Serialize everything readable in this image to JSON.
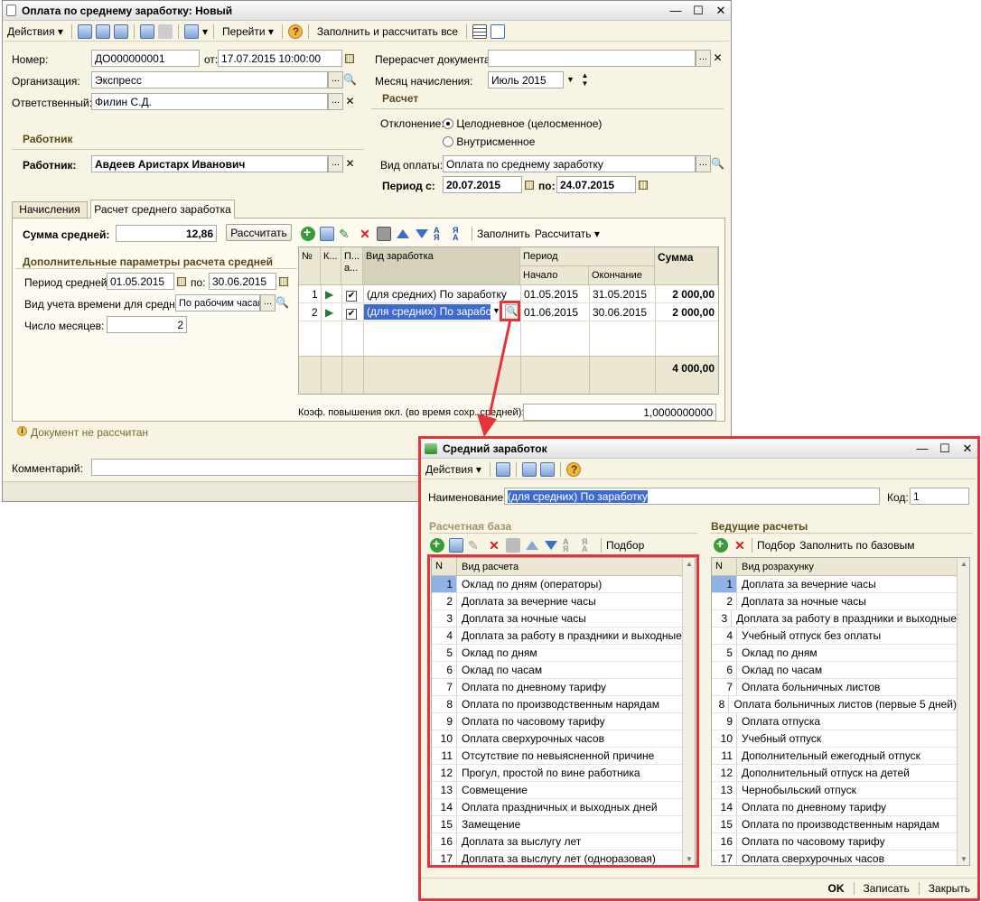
{
  "main": {
    "title": "Оплата по среднему заработку: Новый",
    "toolbar": {
      "actions": "Действия",
      "goto": "Перейти",
      "fill_calc": "Заполнить и рассчитать все"
    },
    "fields": {
      "number_label": "Номер:",
      "number": "ДО000000001",
      "from_label": "от:",
      "date": "17.07.2015 10:00:00",
      "org_label": "Организация:",
      "org": "Экспресс",
      "resp_label": "Ответственный:",
      "resp": "Филин С.Д.",
      "recalc_label": "Перерасчет документа:",
      "recalc": "",
      "month_label": "Месяц начисления:",
      "month": "Июль 2015",
      "calc_section": "Расчет",
      "deviation_label": "Отклонение:",
      "dev_opt1": "Целодневное (целосменное)",
      "dev_opt2": "Внутрисменное",
      "worker_section": "Работник",
      "worker_label": "Работник:",
      "worker": "Авдеев Аристарх Иванович",
      "paytype_label": "Вид оплаты:",
      "paytype": "Оплата по среднему заработку",
      "period_label": "Период с:",
      "period_from": "20.07.2015",
      "period_to_label": "по:",
      "period_to": "24.07.2015"
    },
    "tabs": [
      "Начисления",
      "Расчет среднего заработка"
    ],
    "avg": {
      "sum_label": "Сумма средней:",
      "sum": "12,86",
      "calc_btn": "Рассчитать",
      "params_section": "Дополнительные параметры расчета средней",
      "period_label": "Период средней:",
      "period_from": "01.05.2015",
      "to_label": "по:",
      "period_to": "30.06.2015",
      "time_label": "Вид учета времени для средней:",
      "time": "По рабочим часам",
      "months_label": "Число месяцев:",
      "months": "2"
    },
    "grid_toolbar": {
      "fill": "Заполнить",
      "calc": "Рассчитать"
    },
    "grid": {
      "headers": {
        "n": "№",
        "k": "К...",
        "p": "П... а...",
        "type": "Вид заработка",
        "period": "Период",
        "start": "Начало",
        "end": "Окончание",
        "sum": "Сумма"
      },
      "rows": [
        {
          "n": "1",
          "type": "(для средних) По заработку",
          "start": "01.05.2015",
          "end": "31.05.2015",
          "sum": "2 000,00"
        },
        {
          "n": "2",
          "type": "(для средних) По заработку",
          "start": "01.06.2015",
          "end": "30.06.2015",
          "sum": "2 000,00"
        }
      ],
      "total": "4 000,00"
    },
    "coef_label": "Коэф. повышения окл. (во время сохр. средней):",
    "coef": "1,0000000000",
    "status": "Документ не рассчитан",
    "comment_label": "Комментарий:"
  },
  "dialog": {
    "title": "Средний заработок",
    "actions": "Действия",
    "name_label": "Наименование:",
    "name": "(для средних) По заработку",
    "code_label": "Код:",
    "code": "1",
    "base_section": "Расчетная база",
    "base_pick": "Подбор",
    "base_col_n": "N",
    "base_col_v": "Вид расчета",
    "base_items": [
      "Оклад по дням (операторы)",
      "Доплата за вечерние часы",
      "Доплата за ночные часы",
      "Доплата за работу в праздники и выходные",
      "Оклад по дням",
      "Оклад по часам",
      "Оплата по дневному тарифу",
      "Оплата по производственным нарядам",
      "Оплата по часовому тарифу",
      "Оплата сверхурочных часов",
      "Отсутствие по невыясненной причине",
      "Прогул, простой по вине работника",
      "Совмещение",
      "Оплата праздничных и выходных дней",
      "Замещение",
      "Доплата за выслугу лет",
      "Доплата за выслугу лет (одноразовая)"
    ],
    "lead_section": "Ведущие расчеты",
    "lead_pick": "Подбор",
    "lead_fill": "Заполнить по базовым",
    "lead_col_n": "N",
    "lead_col_v": "Вид розрахунку",
    "lead_items": [
      "Доплата за вечерние часы",
      "Доплата за ночные часы",
      "Доплата за работу в праздники и выходные",
      "Учебный отпуск без оплаты",
      "Оклад по дням",
      "Оклад по часам",
      "Оплата больничных листов",
      "Оплата больничных листов (первые 5 дней)",
      "Оплата отпуска",
      "Учебный отпуск",
      "Дополнительный ежегодный отпуск",
      "Дополнительный отпуск на детей",
      "Чернобыльский отпуск",
      "Оплата по дневному тарифу",
      "Оплата по производственным нарядам",
      "Оплата по часовому тарифу",
      "Оплата сверхурочных часов"
    ],
    "ok": "OK",
    "save": "Записать",
    "close": "Закрыть"
  },
  "colors": {
    "red": "#e8323a",
    "selection": "#3d6bd1",
    "panel": "#f8f4e4"
  }
}
